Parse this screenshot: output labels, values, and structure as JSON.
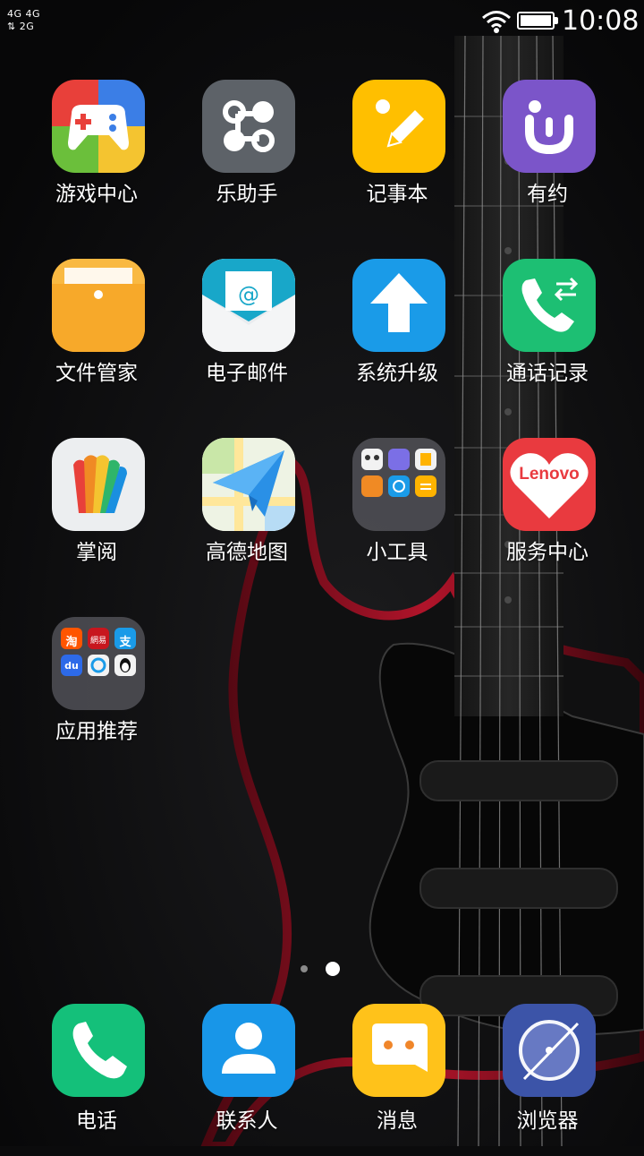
{
  "status_bar": {
    "signal_line1": "4G 4G",
    "signal_line2": "⇅ 2G",
    "time": "10:08",
    "icons": [
      "wifi-icon",
      "battery-icon"
    ]
  },
  "home": {
    "apps": [
      {
        "label": "游戏中心",
        "icon": "gamepad-icon"
      },
      {
        "label": "乐助手",
        "icon": "nodes-icon"
      },
      {
        "label": "记事本",
        "icon": "pencil-icon"
      },
      {
        "label": "有约",
        "icon": "smile-icon"
      },
      {
        "label": "文件管家",
        "icon": "folder-icon"
      },
      {
        "label": "电子邮件",
        "icon": "mail-icon"
      },
      {
        "label": "系统升级",
        "icon": "arrow-up-icon"
      },
      {
        "label": "通话记录",
        "icon": "call-log-icon"
      },
      {
        "label": "掌阅",
        "icon": "book-fan-icon"
      },
      {
        "label": "高德地图",
        "icon": "paper-plane-map-icon"
      },
      {
        "label": "小工具",
        "icon": "tools-folder-icon"
      },
      {
        "label": "服务中心",
        "icon": "lenovo-heart-icon",
        "icon_text": "Lenovo"
      },
      {
        "label": "应用推荐",
        "icon": "apps-folder-icon",
        "folder_texts": [
          "淘",
          "網易",
          "支",
          "du",
          "",
          ""
        ]
      }
    ]
  },
  "page_indicator": {
    "pages": 2,
    "current": 2
  },
  "dock": {
    "apps": [
      {
        "label": "电话",
        "icon": "phone-icon"
      },
      {
        "label": "联系人",
        "icon": "contact-icon"
      },
      {
        "label": "消息",
        "icon": "message-icon"
      },
      {
        "label": "浏览器",
        "icon": "compass-icon"
      }
    ]
  },
  "colors": {
    "game_red": "#e8403a",
    "game_blue": "#3b7ee6",
    "game_green": "#6bbf3b",
    "game_yellow": "#f4c430",
    "helper_gray": "#5d6268",
    "notes_yellow": "#ffbf00",
    "youyue_purple": "#7b55c9",
    "files_orange": "#f7a92a",
    "mail_teal": "#18a7c9",
    "update_blue": "#1a9be8",
    "calllog_green": "#1dbf73",
    "service_red": "#e93a3f",
    "phone_green": "#14c07a",
    "contacts_blue": "#1896e8",
    "message_yellow": "#ffc21a",
    "browser_indigo": "#3c54a8"
  }
}
